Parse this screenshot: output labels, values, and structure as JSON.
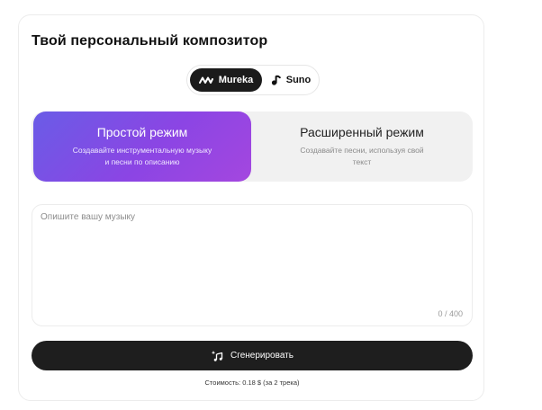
{
  "title": "Твой персональный композитор",
  "engines": {
    "mureka_label": "Mureka",
    "suno_label": "Suno",
    "selected": "Mureka"
  },
  "modes": {
    "simple": {
      "title": "Простой режим",
      "description": "Создавайте инструментальную музыку и песни по описанию"
    },
    "advanced": {
      "title": "Расширенный режим",
      "description": "Создавайте песни, используя свой текст"
    },
    "selected": "simple"
  },
  "prompt": {
    "placeholder": "Опишите вашу музыку",
    "value": "",
    "counter": "0 / 400"
  },
  "generate": {
    "label": "Сгенерировать"
  },
  "cost_text": "Стоимость: 0.18 $ (за 2 трека)",
  "colors": {
    "accent_gradient_start": "#6a5ce6",
    "accent_gradient_end": "#a447df",
    "dark": "#1e1e1e"
  },
  "icons": [
    "mureka-logo-icon",
    "suno-logo-icon",
    "music-sparkle-icon"
  ]
}
